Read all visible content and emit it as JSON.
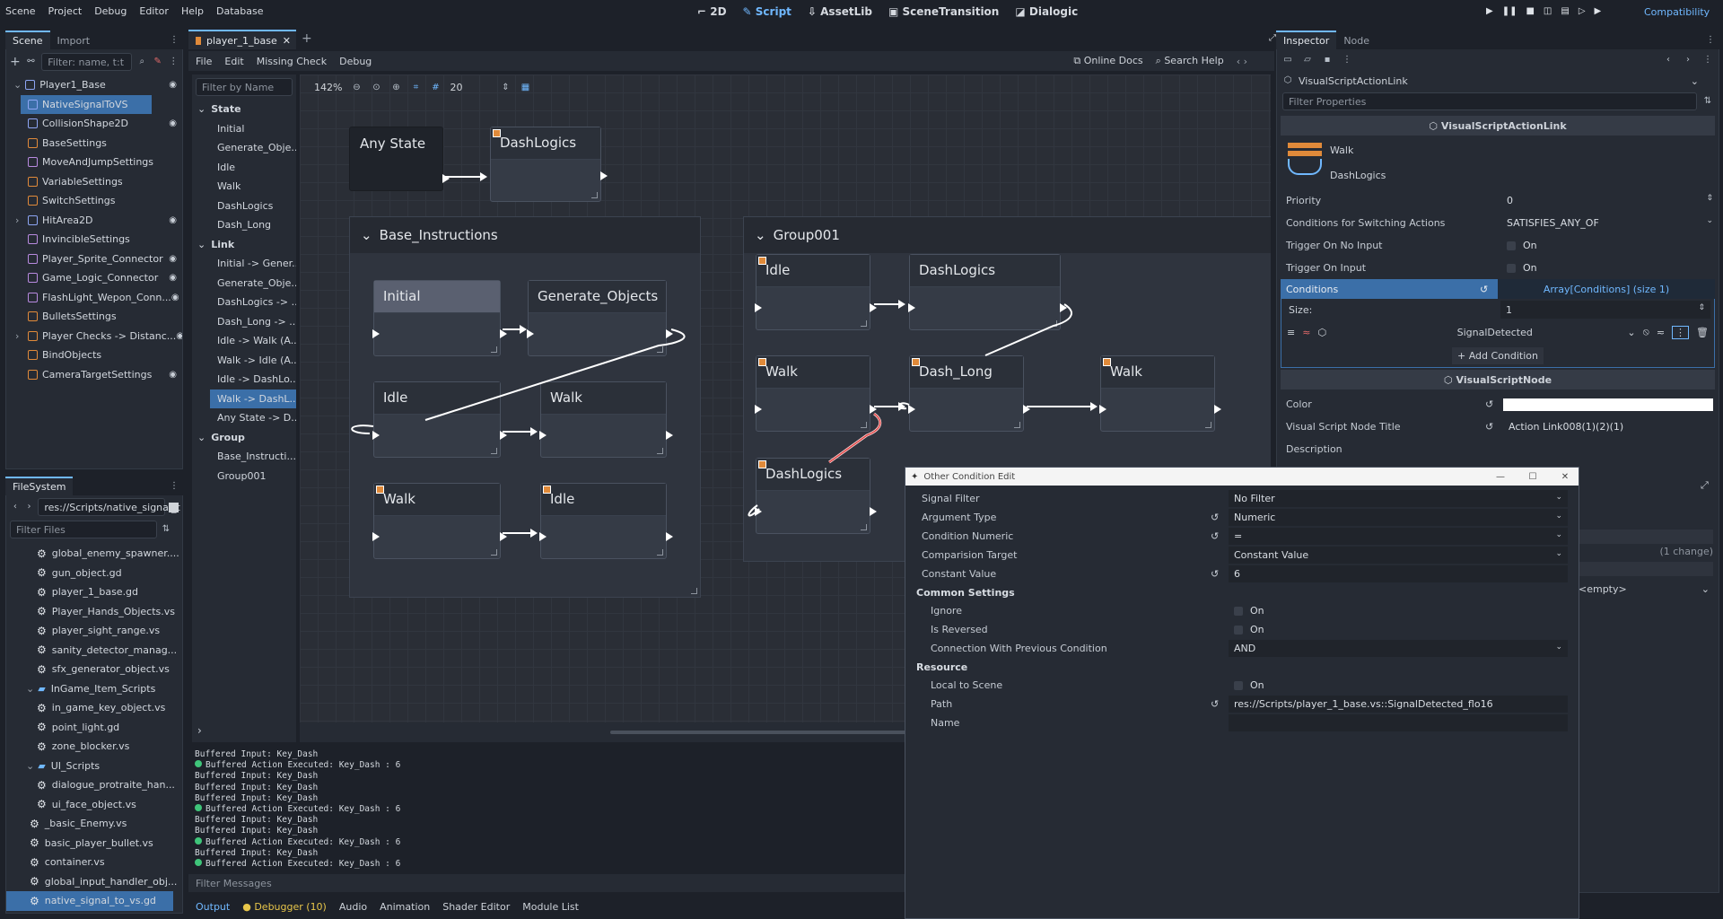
{
  "menu": [
    "Scene",
    "Project",
    "Debug",
    "Editor",
    "Help",
    "Database"
  ],
  "workspaces": [
    {
      "label": "2D",
      "icon": "2d-icon",
      "active": false
    },
    {
      "label": "Script",
      "icon": "script-icon",
      "active": true
    },
    {
      "label": "AssetLib",
      "icon": "assetlib-icon",
      "active": false
    },
    {
      "label": "SceneTransition",
      "icon": "scenetransition-icon",
      "active": false
    },
    {
      "label": "Dialogic",
      "icon": "dialogic-icon",
      "active": false
    }
  ],
  "renderer": "Compatibility",
  "scene_dock": {
    "tabs": [
      "Scene",
      "Import"
    ],
    "filter_placeholder": "Filter: name, t:t",
    "items": [
      {
        "label": "Player1_Base",
        "color": "#8da5f3",
        "indent": 0,
        "eye": true
      },
      {
        "label": "NativeSignalToVS",
        "color": "#8da5f3",
        "indent": 1,
        "eye": false,
        "selected": true
      },
      {
        "label": "CollisionShape2D",
        "color": "#8da5f3",
        "indent": 1,
        "eye": true
      },
      {
        "label": "BaseSettings",
        "color": "#e08a3a",
        "indent": 1,
        "eye": false
      },
      {
        "label": "MoveAndJumpSettings",
        "color": "#b88ae0",
        "indent": 1,
        "eye": false
      },
      {
        "label": "VariableSettings",
        "color": "#e08a3a",
        "indent": 1,
        "eye": false
      },
      {
        "label": "SwitchSettings",
        "color": "#e08a3a",
        "indent": 1,
        "eye": false
      },
      {
        "label": "HitArea2D",
        "color": "#8da5f3",
        "indent": 1,
        "eye": true
      },
      {
        "label": "InvincibleSettings",
        "color": "#b88ae0",
        "indent": 1,
        "eye": false
      },
      {
        "label": "Player_Sprite_Connector",
        "color": "#b88ae0",
        "indent": 1,
        "eye": true
      },
      {
        "label": "Game_Logic_Connector",
        "color": "#b88ae0",
        "indent": 1,
        "eye": true
      },
      {
        "label": "FlashLight_Wepon_Conn...",
        "color": "#b88ae0",
        "indent": 1,
        "eye": true
      },
      {
        "label": "BulletsSettings",
        "color": "#e08a3a",
        "indent": 1,
        "eye": false
      },
      {
        "label": "Player Checks -> Distanc...",
        "color": "#e08a3a",
        "indent": 1,
        "eye": true
      },
      {
        "label": "BindObjects",
        "color": "#e08a3a",
        "indent": 1,
        "eye": false
      },
      {
        "label": "CameraTargetSettings",
        "color": "#e08a3a",
        "indent": 1,
        "eye": true
      }
    ]
  },
  "filesystem": {
    "tab": "FileSystem",
    "path": "res://Scripts/native_signal_t",
    "filter_placeholder": "Filter Files",
    "items": [
      {
        "label": "global_enemy_spawner....",
        "type": "file",
        "indent": 2
      },
      {
        "label": "gun_object.gd",
        "type": "file",
        "indent": 2
      },
      {
        "label": "player_1_base.gd",
        "type": "file",
        "indent": 2
      },
      {
        "label": "Player_Hands_Objects.vs",
        "type": "file",
        "indent": 2
      },
      {
        "label": "player_sight_range.vs",
        "type": "file",
        "indent": 2
      },
      {
        "label": "sanity_detector_manag...",
        "type": "file",
        "indent": 2
      },
      {
        "label": "sfx_generator_object.vs",
        "type": "file",
        "indent": 2
      },
      {
        "label": "InGame_Item_Scripts",
        "type": "folder",
        "indent": 1
      },
      {
        "label": "in_game_key_object.vs",
        "type": "file",
        "indent": 2
      },
      {
        "label": "point_light.gd",
        "type": "file",
        "indent": 2
      },
      {
        "label": "zone_blocker.vs",
        "type": "file",
        "indent": 2
      },
      {
        "label": "UI_Scripts",
        "type": "folder",
        "indent": 1
      },
      {
        "label": "dialogue_protraite_han...",
        "type": "file",
        "indent": 2
      },
      {
        "label": "ui_face_object.vs",
        "type": "file",
        "indent": 2
      },
      {
        "label": "_basic_Enemy.vs",
        "type": "file",
        "indent": 1
      },
      {
        "label": "basic_player_bullet.vs",
        "type": "file",
        "indent": 1
      },
      {
        "label": "container.vs",
        "type": "file",
        "indent": 1
      },
      {
        "label": "global_input_handler_obj...",
        "type": "file",
        "indent": 1
      },
      {
        "label": "native_signal_to_vs.gd",
        "type": "file",
        "indent": 1,
        "selected": true
      }
    ]
  },
  "script_tab": "player_1_base",
  "script_menu": [
    "File",
    "Edit",
    "Missing Check",
    "Debug"
  ],
  "online_docs": "Online Docs",
  "search_help": "Search Help",
  "outline": {
    "filter_placeholder": "Filter by Name",
    "sections": [
      {
        "title": "State",
        "items": [
          "Initial",
          "Generate_Obje...",
          "Idle",
          "Walk",
          "DashLogics",
          "Dash_Long"
        ]
      },
      {
        "title": "Link",
        "items": [
          "Initial -> Gener...",
          "Generate_Obje...",
          "DashLogics -> ...",
          "Dash_Long -> ...",
          "Idle -> Walk (A...",
          "Walk -> Idle (A...",
          "Idle -> DashLo...",
          "Walk -> DashL...",
          "Any State -> D..."
        ]
      },
      {
        "title": "Group",
        "items": [
          "Base_Instructi...",
          "Group001"
        ]
      }
    ],
    "selected": "Walk -> DashL..."
  },
  "graph_toolbar": {
    "zoom": "142%",
    "snap": "20"
  },
  "graph": {
    "any_state": "Any State",
    "nodes": {
      "dashlogics_top": "DashLogics",
      "initial": "Initial",
      "generate": "Generate_Objects",
      "idle_a": "Idle",
      "walk_a": "Walk",
      "walk_b": "Walk",
      "idle_b": "Idle",
      "g_idle": "Idle",
      "g_dashlogics": "DashLogics",
      "g_walk": "Walk",
      "g_dashlong": "Dash_Long",
      "g_walk2": "Walk",
      "g_dashlogics2": "DashLogics"
    },
    "groups": {
      "base": "Base_Instructions",
      "g001": "Group001"
    }
  },
  "console": {
    "lines": [
      {
        "text": "Buffered Input: Key_Dash",
        "dot": false
      },
      {
        "text": "Buffered Action Executed: Key_Dash : 6",
        "dot": true
      },
      {
        "text": "Buffered Input: Key_Dash",
        "dot": false
      },
      {
        "text": "Buffered Input: Key_Dash",
        "dot": false
      },
      {
        "text": "Buffered Input: Key_Dash",
        "dot": false
      },
      {
        "text": "Buffered Action Executed: Key_Dash : 6",
        "dot": true
      },
      {
        "text": "Buffered Input: Key_Dash",
        "dot": false
      },
      {
        "text": "Buffered Input: Key_Dash",
        "dot": false
      },
      {
        "text": "Buffered Action Executed: Key_Dash : 6",
        "dot": true
      },
      {
        "text": "Buffered Input: Key_Dash",
        "dot": false
      },
      {
        "text": "Buffered Action Executed: Key_Dash : 6",
        "dot": true
      }
    ],
    "filter_placeholder": "Filter Messages"
  },
  "bottom_tabs": [
    "Output",
    "Debugger (10)",
    "Audio",
    "Animation",
    "Shader Editor",
    "Module List"
  ],
  "inspector": {
    "tabs": [
      "Inspector",
      "Node"
    ],
    "object": "VisualScriptActionLink",
    "filter_placeholder": "Filter Properties",
    "section": "VisualScriptActionLink",
    "from": "Walk",
    "to": "DashLogics",
    "rows": [
      {
        "label": "Priority",
        "value": "0"
      },
      {
        "label": "Conditions for Switching Actions",
        "value": "SATISFIES_ANY_OF"
      },
      {
        "label": "Trigger On No Input",
        "value": "On"
      },
      {
        "label": "Trigger On Input",
        "value": "On"
      }
    ],
    "conditions_label": "Conditions",
    "conditions_value": "Array[Conditions] (size 1)",
    "size_label": "Size:",
    "size_value": "1",
    "condition_item": "SignalDetected",
    "add_condition": "Add Condition",
    "node_section": "VisualScriptNode",
    "color_label": "Color",
    "title_label": "Visual Script Node Title",
    "title_value": "Action Link008(1)(2)(1)",
    "description_label": "Description",
    "changes": "(1 change)",
    "empty": "<empty>"
  },
  "dialog": {
    "title": "Other Condition Edit",
    "rows": [
      {
        "label": "Signal Filter",
        "value": "No Filter",
        "dropdown": true,
        "revert": false
      },
      {
        "label": "Argument Type",
        "value": "Numeric",
        "dropdown": true,
        "revert": true
      },
      {
        "label": "Condition Numeric",
        "value": "=",
        "dropdown": true,
        "revert": true
      },
      {
        "label": "Comparision Target",
        "value": "Constant Value",
        "dropdown": true,
        "revert": false
      },
      {
        "label": "Constant Value",
        "value": "6",
        "dropdown": false,
        "revert": true
      }
    ],
    "common_title": "Common Settings",
    "common": [
      {
        "label": "Ignore",
        "value": "On",
        "check": true
      },
      {
        "label": "Is Reversed",
        "value": "On",
        "check": true
      },
      {
        "label": "Connection With Previous Condition",
        "value": "AND",
        "dropdown": true
      }
    ],
    "resource_title": "Resource",
    "resource": [
      {
        "label": "Local to Scene",
        "value": "On",
        "check": true
      },
      {
        "label": "Path",
        "value": "res://Scripts/player_1_base.vs::SignalDetected_flo16"
      },
      {
        "label": "Name",
        "value": ""
      }
    ]
  }
}
